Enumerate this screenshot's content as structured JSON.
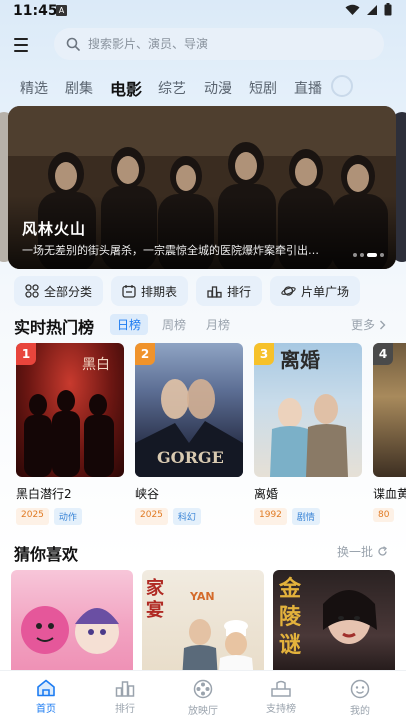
{
  "status": {
    "time": "11:45",
    "notification_icon": "A"
  },
  "search": {
    "placeholder": "搜索影片、演员、导演"
  },
  "categories": {
    "tabs": [
      "精选",
      "剧集",
      "电影",
      "综艺",
      "动漫",
      "短剧",
      "直播"
    ],
    "active": "电影"
  },
  "banner": {
    "title": "风林火山",
    "description": "一场无差别的街头屠杀，一宗震惊全城的医院爆炸案牵引出…"
  },
  "quick_links": [
    {
      "label": "全部分类",
      "icon": "grid-icon"
    },
    {
      "label": "排期表",
      "icon": "calendar-icon"
    },
    {
      "label": "排行",
      "icon": "podium-icon"
    },
    {
      "label": "片单广场",
      "icon": "planet-icon"
    }
  ],
  "hot": {
    "title": "实时热门榜",
    "tabs": [
      "日榜",
      "周榜",
      "月榜"
    ],
    "more": "更多",
    "items": [
      {
        "rank": "1",
        "name": "黑白潜行2",
        "year": "2025",
        "genre": "动作",
        "badge_color": "#e8453c"
      },
      {
        "rank": "2",
        "name": "峡谷",
        "year": "2025",
        "genre": "科幻",
        "badge_color": "#f0932b"
      },
      {
        "rank": "3",
        "name": "离婚",
        "year": "1992",
        "genre": "剧情",
        "badge_color": "#f6c12a"
      },
      {
        "rank": "4",
        "name": "谍血黄",
        "year": "80",
        "genre": "",
        "badge_color": "#4a4a4a"
      }
    ]
  },
  "guess": {
    "title": "猜你喜欢",
    "refresh": "换一批"
  },
  "bottom_nav": [
    {
      "label": "首页",
      "icon": "home-icon",
      "active": true
    },
    {
      "label": "排行",
      "icon": "rank-icon",
      "active": false
    },
    {
      "label": "放映厅",
      "icon": "film-reel-icon",
      "active": false
    },
    {
      "label": "支持榜",
      "icon": "support-icon",
      "active": false
    },
    {
      "label": "我的",
      "icon": "profile-icon",
      "active": false
    }
  ],
  "colors": {
    "accent": "#1d7cf2",
    "year_tag": "#e07b24",
    "genre_tag": "#3a84d6"
  }
}
